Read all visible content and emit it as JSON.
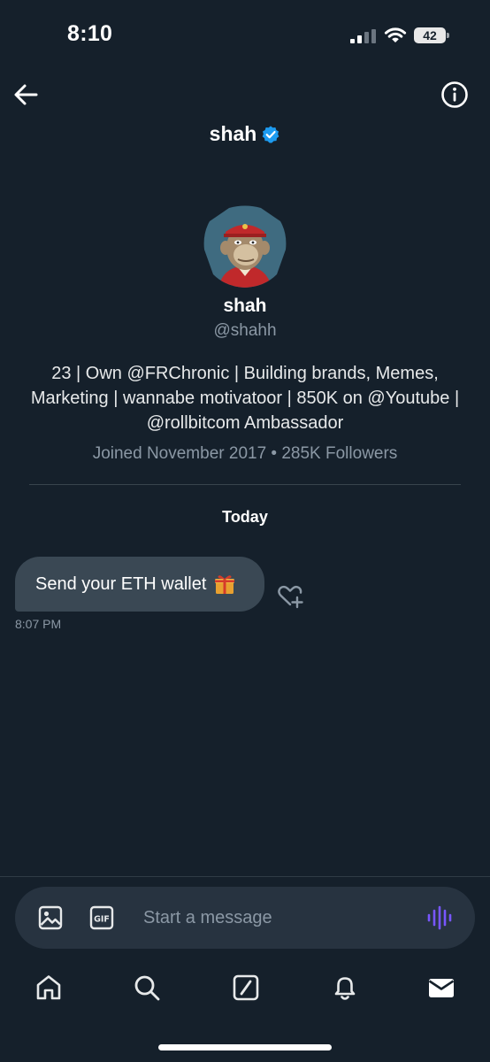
{
  "status_bar": {
    "time": "8:10",
    "battery": "42"
  },
  "header": {
    "title": "shah",
    "back_icon": "arrow-left-icon",
    "info_icon": "info-icon",
    "verified_icon": "verified-badge-icon"
  },
  "profile": {
    "name": "shah",
    "handle": "@shahh",
    "bio": "23 | Own @FRChronic | Building brands, Memes, Marketing | wannabe motivatoor | 850K on @Youtube | @rollbitcom Ambassador",
    "meta": "Joined November 2017 • 285K Followers",
    "avatar_icon": "ape-avatar-icon"
  },
  "conversation": {
    "date_label": "Today",
    "messages": [
      {
        "text": "Send your ETH wallet",
        "emoji_icon": "gift-icon",
        "time": "8:07 PM",
        "reaction_icon": "heart-plus-icon"
      }
    ]
  },
  "composer": {
    "placeholder": "Start a message",
    "image_icon": "image-icon",
    "gif_icon": "gif-icon",
    "voice_icon": "voice-message-icon"
  },
  "bottom_nav": [
    {
      "icon": "home-icon"
    },
    {
      "icon": "search-icon"
    },
    {
      "icon": "grok-icon"
    },
    {
      "icon": "notifications-bell-icon"
    },
    {
      "icon": "messages-envelope-icon"
    }
  ],
  "colors": {
    "background": "#15202b",
    "bubble": "#3a4854",
    "composer": "#273340",
    "accent_blue": "#1d9bf0",
    "voice_purple": "#7856ff",
    "muted_text": "#8b98a5"
  }
}
